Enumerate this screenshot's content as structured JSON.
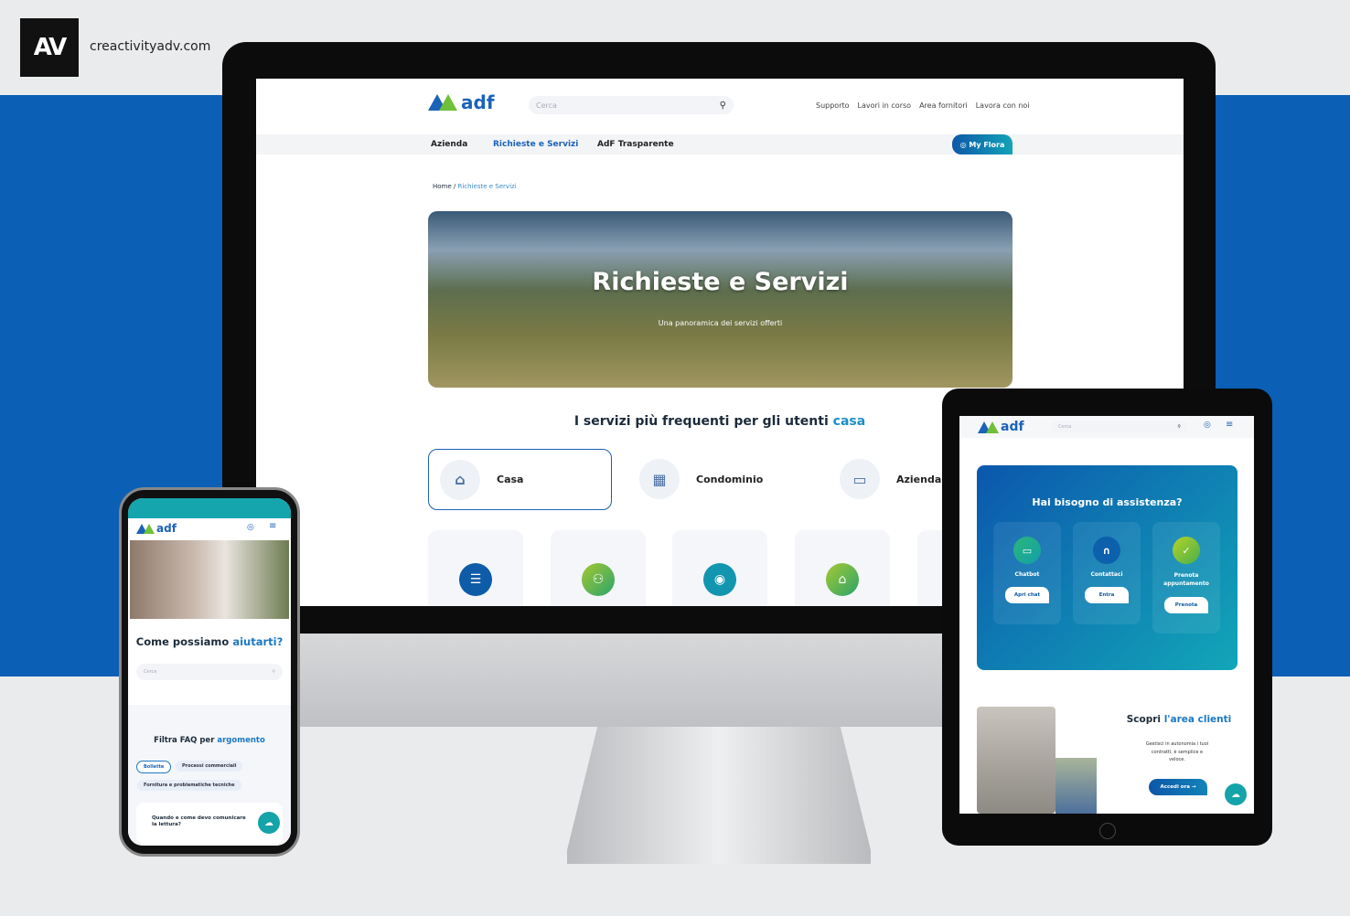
{
  "brand": {
    "mark": "AV",
    "site": "creactivityadv.com"
  },
  "desktop": {
    "logo": "adf",
    "search_placeholder": "Cerca",
    "top_links": [
      "Supporto",
      "Lavori in corso",
      "Area fornitori",
      "Lavora con noi"
    ],
    "nav": [
      {
        "label": "Azienda"
      },
      {
        "label": "Richieste e Servizi",
        "active": true
      },
      {
        "label": "AdF Trasparente"
      }
    ],
    "my_flora": "My Flora",
    "breadcrumb": {
      "home": "Home",
      "sep": "/",
      "current": "Richieste e Servizi"
    },
    "hero": {
      "title": "Richieste e Servizi",
      "subtitle": "Una panoramica dei servizi offerti"
    },
    "section": {
      "title": "I servizi più frequenti per gli utenti",
      "highlight": "casa"
    },
    "tabs": [
      {
        "label": "Casa",
        "icon": "house-icon",
        "active": true
      },
      {
        "label": "Condominio",
        "icon": "building-icon"
      },
      {
        "label": "Azienda",
        "icon": "briefcase-icon"
      }
    ],
    "service_cards": [
      {
        "icon": "document-icon",
        "color": "#0e5ba8"
      },
      {
        "icon": "users-icon",
        "color": "#5cb84a"
      },
      {
        "icon": "user-circle-icon",
        "color": "#1296b0"
      },
      {
        "icon": "house-icon",
        "color": "#6cbf3a"
      }
    ]
  },
  "tablet": {
    "logo": "adf",
    "search_placeholder": "Cerca",
    "assist": {
      "title": "Hai bisogno di assistenza?",
      "items": [
        {
          "label": "Chatbot",
          "button": "Apri chat",
          "icon": "chat-icon"
        },
        {
          "label": "Contattaci",
          "button": "Entra",
          "icon": "headset-icon"
        },
        {
          "label": "Prenota appuntamento",
          "button": "Prenota",
          "icon": "check-icon"
        }
      ]
    },
    "area": {
      "title": "Scopri",
      "highlight": "l'area clienti",
      "text": "Gestisci in autonomia i tuoi contratti, è semplice e veloce.",
      "button": "Accedi ora →"
    }
  },
  "phone": {
    "logo": "adf",
    "heading": "Come possiamo",
    "heading_highlight": "aiutarti?",
    "search_placeholder": "Cerca",
    "faq_title": "Filtra FAQ per",
    "faq_highlight": "argomento",
    "chips": [
      {
        "label": "Bollette",
        "active": true
      },
      {
        "label": "Processi commerciali"
      },
      {
        "label": "Fornitura e problematiche tecniche"
      }
    ],
    "faq_item": "Quando e come devo comunicare la lettura?"
  },
  "colors": {
    "band": "#0b5fb4",
    "accent": "#1b63b8",
    "teal": "#13a3b8"
  }
}
